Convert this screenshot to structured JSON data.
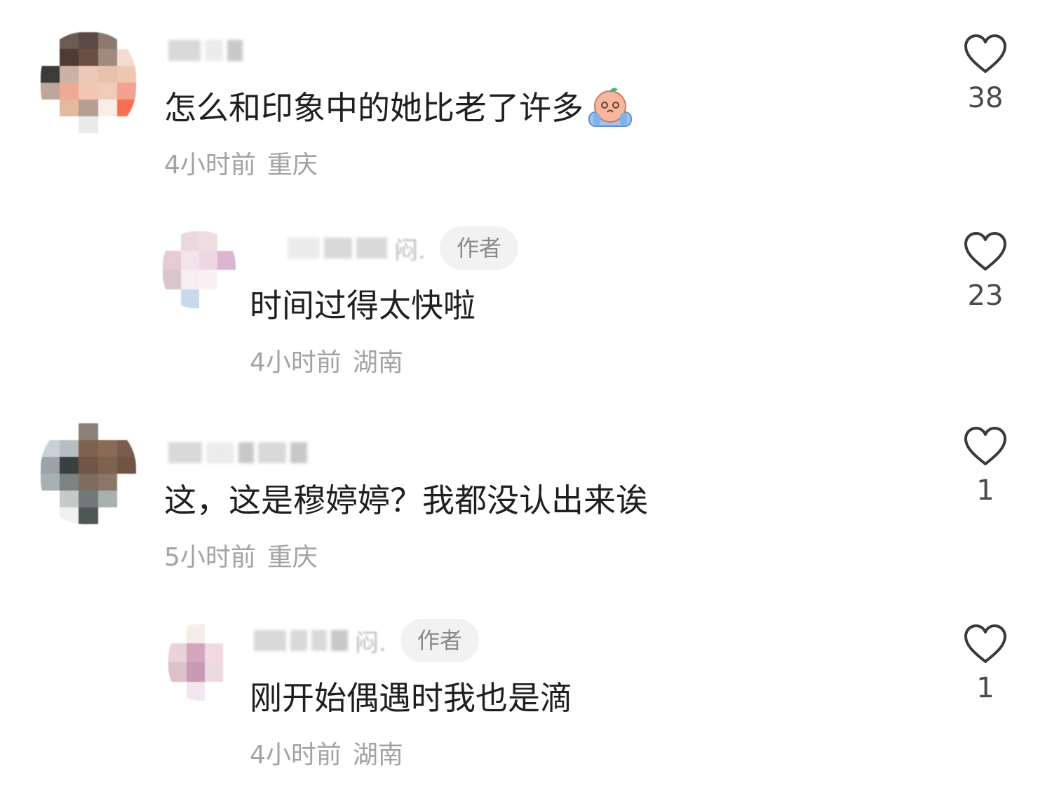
{
  "comments": [
    {
      "text": "怎么和印象中的她比老了许多",
      "emoji": "crying-face-emoji",
      "time": "4小时前",
      "location": "重庆",
      "likes": "38",
      "is_reply": false,
      "is_author": false
    },
    {
      "name_tail": "闷.",
      "author_badge": "作者",
      "text": "时间过得太快啦",
      "time": "4小时前",
      "location": "湖南",
      "likes": "23",
      "is_reply": true,
      "is_author": true
    },
    {
      "text": "这，这是穆婷婷？我都没认出来诶",
      "time": "5小时前",
      "location": "重庆",
      "likes": "1",
      "is_reply": false,
      "is_author": false
    },
    {
      "name_tail": "闷.",
      "author_badge": "作者",
      "text": "刚开始偶遇时我也是滴",
      "time": "4小时前",
      "location": "湖南",
      "likes": "1",
      "is_reply": true,
      "is_author": true
    }
  ],
  "icons": {
    "like": "heart-outline-icon",
    "avatar": "blurred-avatar"
  },
  "colors": {
    "text": "#1f1f1f",
    "meta": "#a3a3a3",
    "badge_bg": "#f2f2f2",
    "badge_text": "#8a8a8a",
    "heart_stroke": "#3a3a3a"
  }
}
